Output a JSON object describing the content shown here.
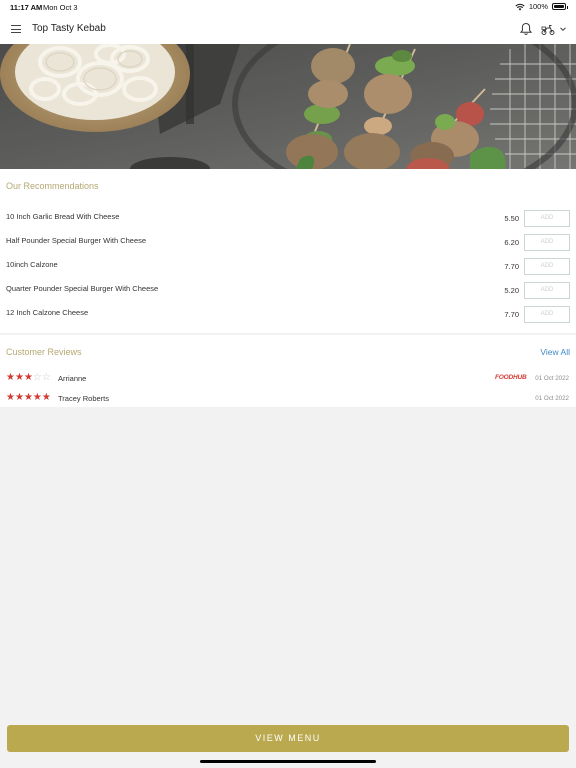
{
  "status_bar": {
    "time": "11:17 AM",
    "date": "Mon Oct 3",
    "battery": "100%"
  },
  "nav": {
    "title": "Top Tasty Kebab"
  },
  "recommendations": {
    "title": "Our Recommendations",
    "add_label": "ADD",
    "items": [
      {
        "name": "10 Inch Garlic Bread With Cheese",
        "price": "5.50"
      },
      {
        "name": "Half Pounder Special Burger With Cheese",
        "price": "6.20"
      },
      {
        "name": "10inch Calzone",
        "price": "7.70"
      },
      {
        "name": "Quarter Pounder Special Burger With Cheese",
        "price": "5.20"
      },
      {
        "name": "12 Inch Calzone Cheese",
        "price": "7.70"
      }
    ]
  },
  "reviews": {
    "title": "Customer Reviews",
    "view_all": "View All",
    "items": [
      {
        "name": "Arrianne",
        "rating": 3,
        "max_rating": 5,
        "source": "FOODHUB",
        "date": "01 Oct 2022"
      },
      {
        "name": "Tracey Roberts",
        "rating": 5,
        "max_rating": 5,
        "source": "",
        "date": "01 Oct 2022"
      }
    ]
  },
  "cta": {
    "label": "VIEW MENU"
  },
  "colors": {
    "accent": "#bba94f",
    "section_title": "#b4a873",
    "star": "#d23a32",
    "link": "#3d8bc9"
  }
}
